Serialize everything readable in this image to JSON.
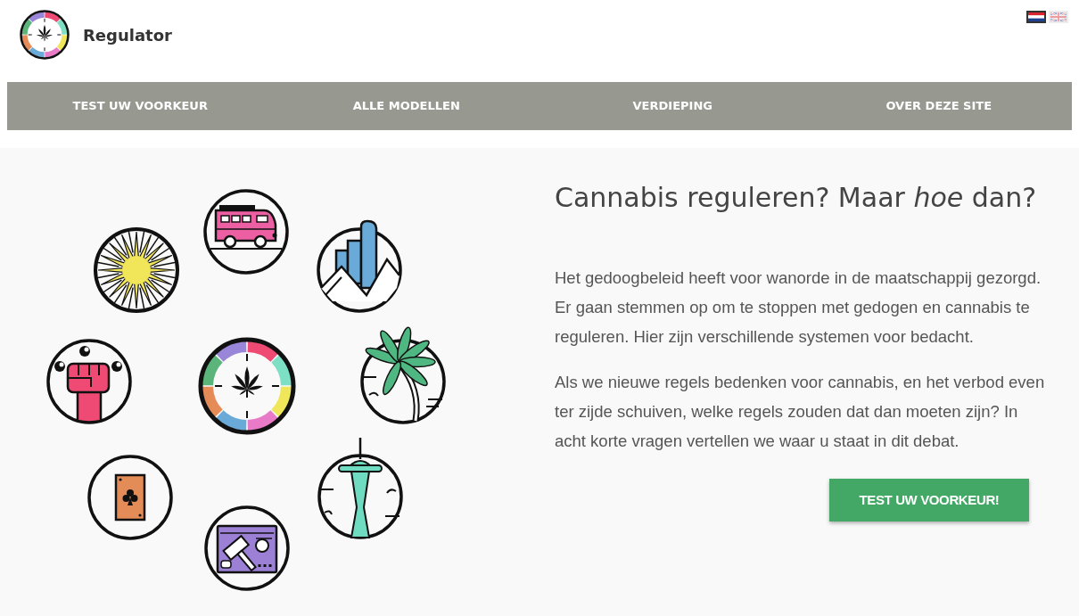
{
  "header": {
    "site_name": "Regulator",
    "languages": [
      {
        "kind": "nl",
        "selected": true
      },
      {
        "kind": "gb",
        "selected": false
      }
    ]
  },
  "nav": {
    "items": [
      {
        "label": "TEST UW VOORKEUR"
      },
      {
        "label": "ALLE MODELLEN"
      },
      {
        "label": "VERDIEPING"
      },
      {
        "label": "OVER DEZE SITE"
      }
    ]
  },
  "hero": {
    "heading": "Cannabis reguleren? Maar *hoe* dan?",
    "paragraphs": [
      "Het gedoogbeleid heeft voor wanorde in de maatschappij gezorgd. Er gaan stemmen op om te stoppen met gedogen en cannabis te reguleren. Hier zijn verschillende systemen voor bedacht.",
      "Als we nieuwe regels bedenken voor cannabis, en het verbod even ter zijde schuiven, welke regels zouden dat dan moeten zijn? In acht korte vragen vertellen we waar u staat in dit debat."
    ],
    "button": "TEST UW VOORKEUR!"
  }
}
